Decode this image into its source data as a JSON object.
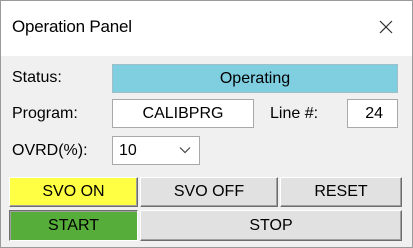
{
  "window": {
    "title": "Operation Panel",
    "close_icon": "close-icon"
  },
  "status": {
    "label": "Status:",
    "value": "Operating",
    "color": "#7fcfe0"
  },
  "program": {
    "label": "Program:",
    "value": "CALIBPRG"
  },
  "line": {
    "label": "Line #:",
    "value": "24"
  },
  "override": {
    "label": "OVRD(%):",
    "selected": "10"
  },
  "buttons": {
    "svo_on": {
      "label": "SVO ON",
      "color": "#ffff44"
    },
    "svo_off": {
      "label": "SVO OFF"
    },
    "reset": {
      "label": "RESET"
    },
    "start": {
      "label": "START",
      "color": "#56ad3a"
    },
    "stop": {
      "label": "STOP"
    }
  }
}
